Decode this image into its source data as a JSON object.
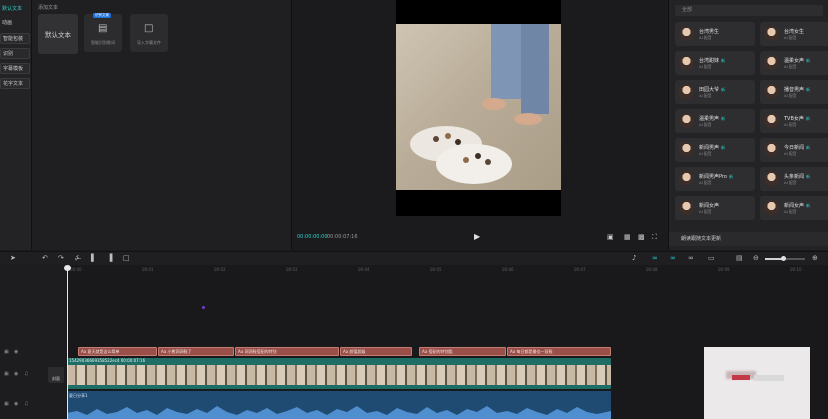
{
  "left_nav": {
    "items": [
      {
        "label": "默认文本"
      },
      {
        "label": "动画"
      },
      {
        "label": "智能包装"
      },
      {
        "label": "识别"
      },
      {
        "label": "字幕模板"
      },
      {
        "label": "花字文本"
      }
    ]
  },
  "asset_panel": {
    "section_title": "添加文本",
    "default_text_tile": "默认文本",
    "tile2": {
      "label": "智能识别歌词",
      "badge": "识别文案",
      "icon": "document-icon"
    },
    "tile3": {
      "label": "导入字幕文件",
      "icon": "folder-icon"
    }
  },
  "preview": {
    "current_time": "00:00:00:00",
    "total_time": "00:00:07:16",
    "play_icon": "play-icon"
  },
  "voice_panel": {
    "search_placeholder": "全部",
    "voices": [
      {
        "name": "台湾男生",
        "sub": "AI 配音"
      },
      {
        "name": "台湾女生",
        "sub": "AI 配音"
      },
      {
        "name": "台湾甜妹",
        "sub": "AI 配音",
        "tag": "新"
      },
      {
        "name": "温柔女声",
        "sub": "AI 配音",
        "tag": "新"
      },
      {
        "name": "田园大爷",
        "sub": "AI 配音",
        "tag": "新"
      },
      {
        "name": "播音男声",
        "sub": "AI 配音",
        "tag": "新"
      },
      {
        "name": "温柔男声",
        "sub": "AI 配音",
        "tag": "新"
      },
      {
        "name": "TVB女声",
        "sub": "AI 配音",
        "tag": "新"
      },
      {
        "name": "新闻男声",
        "sub": "AI 配音",
        "tag": "新"
      },
      {
        "name": "今日新闻",
        "sub": "AI 配音",
        "tag": "新"
      },
      {
        "name": "新闻男声Pro",
        "sub": "AI 配音",
        "tag": "新"
      },
      {
        "name": "头条新闻",
        "sub": "AI 配音",
        "tag": "新"
      },
      {
        "name": "新闻女声",
        "sub": "AI 配音"
      },
      {
        "name": "新闻女声",
        "sub": "AI 配音",
        "tag": "新"
      }
    ],
    "footer": "朗读跟随文本更新"
  },
  "timeline": {
    "ruler_ticks": [
      "00:00",
      "00:01",
      "00:02",
      "00:03",
      "00:04",
      "00:05",
      "00:06",
      "00:07",
      "00:08",
      "00:09",
      "00:10"
    ],
    "cover_label": "封面",
    "text_clips": [
      {
        "label": "Aa 夏天就是这么简单"
      },
      {
        "label": "Aa 小熊洞洞鞋了"
      },
      {
        "label": "Aa 洞洞鞋搭配的特别"
      },
      {
        "label": "Aa 颜值超级"
      },
      {
        "label": "Aa 搭配的特别酷"
      },
      {
        "label": "Aa 每日都是最佳一双鞋"
      }
    ],
    "video_clip": {
      "label": "15429036669358522ec4  00:00:07:16"
    },
    "audio_clip": {
      "label": "夏日分享1"
    }
  },
  "colors": {
    "accent": "#2ad1c9",
    "text_clip": "#9a4f49",
    "video_clip": "#1f6e66",
    "audio_clip": "#1f4a72"
  }
}
